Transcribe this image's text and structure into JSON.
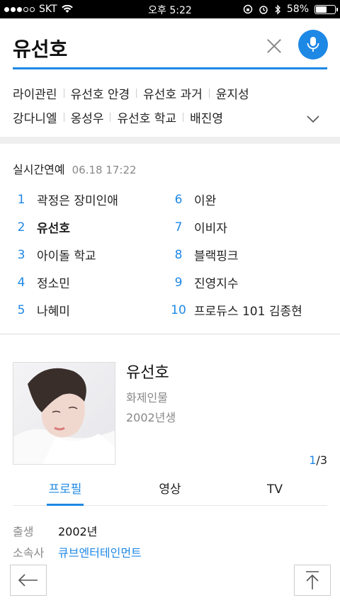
{
  "status_bar": {
    "carrier": "SKT",
    "time": "오후 5:22",
    "battery": "58%",
    "battery_level": 0.58
  },
  "search": {
    "query": "유선호"
  },
  "related_searches": {
    "row1": [
      "라이관린",
      "유선호 안경",
      "유선호 과거",
      "윤지성"
    ],
    "row2": [
      "강다니엘",
      "옹성우",
      "유선호 학교",
      "배진영"
    ]
  },
  "realtime": {
    "title": "실시간연예",
    "timestamp": "06.18 17:22",
    "left": [
      {
        "rank": "1",
        "text": "곽정은 장미인애"
      },
      {
        "rank": "2",
        "text": "유선호"
      },
      {
        "rank": "3",
        "text": "아이돌 학교"
      },
      {
        "rank": "4",
        "text": "정소민"
      },
      {
        "rank": "5",
        "text": "나혜미"
      }
    ],
    "right": [
      {
        "rank": "6",
        "text": "이완"
      },
      {
        "rank": "7",
        "text": "이비자"
      },
      {
        "rank": "8",
        "text": "블랙핑크"
      },
      {
        "rank": "9",
        "text": "진영지수"
      },
      {
        "rank": "10",
        "text": "프로듀스 101 김종현"
      }
    ]
  },
  "person": {
    "name": "유선호",
    "category": "화제인물",
    "born": "2002년생",
    "pager_current": "1",
    "pager_total": "/3"
  },
  "tabs": [
    "프로필",
    "영상",
    "TV"
  ],
  "profile": {
    "birth_label": "출생",
    "birth_value": "2002년",
    "agency_label": "소속사",
    "agency_value": "큐브엔터테인먼트"
  },
  "colors": {
    "accent": "#1e88e5"
  }
}
